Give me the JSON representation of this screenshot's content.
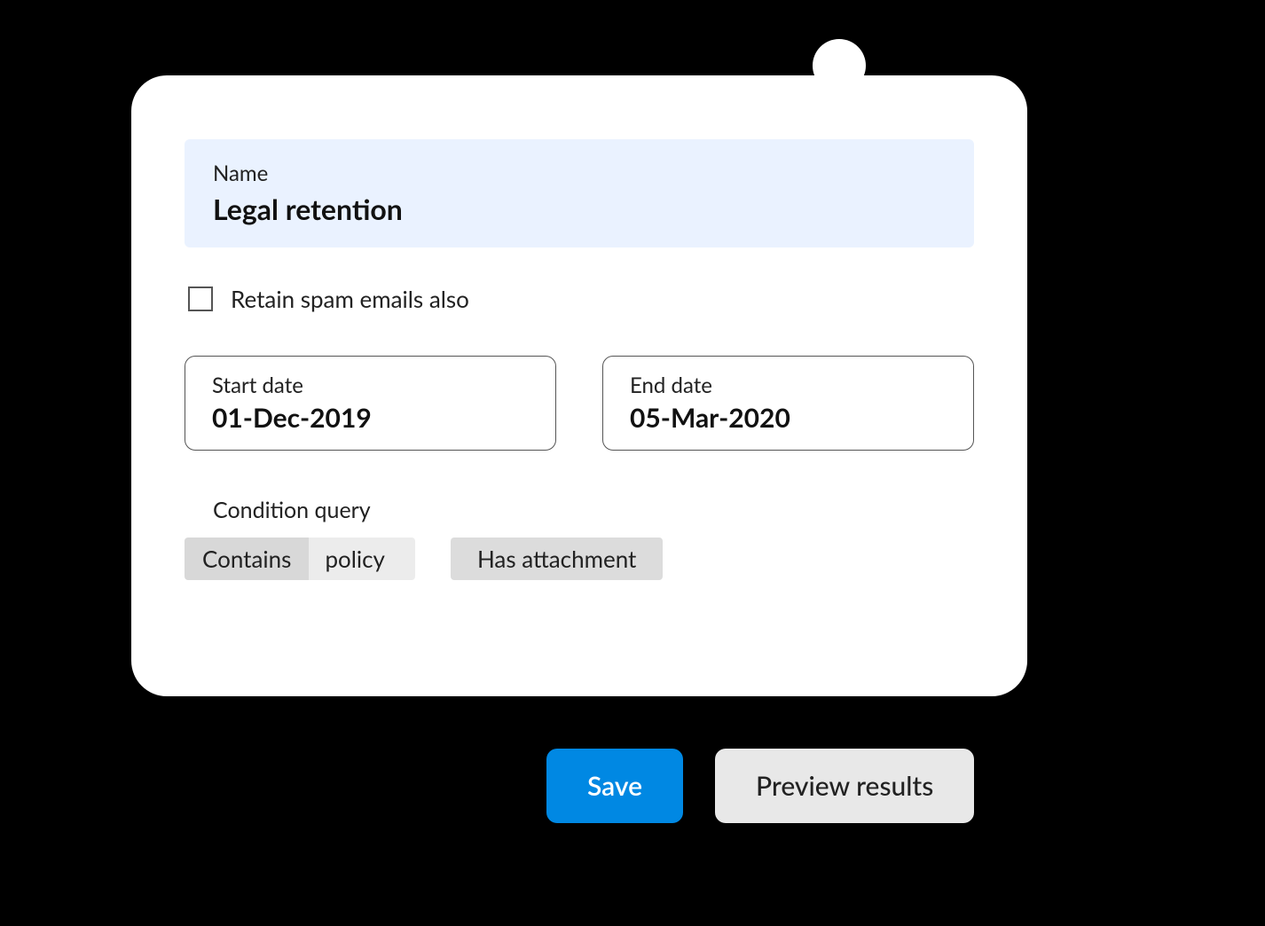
{
  "nameField": {
    "label": "Name",
    "value": "Legal retention"
  },
  "checkbox": {
    "label": "Retain spam emails also",
    "checked": false
  },
  "dates": {
    "start": {
      "label": "Start date",
      "value": "01-Dec-2019"
    },
    "end": {
      "label": "End date",
      "value": "05-Mar-2020"
    }
  },
  "condition": {
    "label": "Condition query",
    "chips": [
      {
        "type": "split",
        "left": "Contains",
        "right": "policy"
      },
      {
        "type": "single",
        "text": "Has attachment"
      }
    ]
  },
  "buttons": {
    "save": "Save",
    "preview": "Preview results"
  }
}
